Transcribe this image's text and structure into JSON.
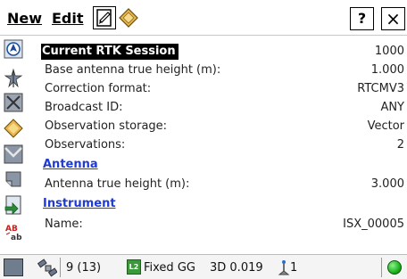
{
  "menu": {
    "new_label": "New",
    "edit_label": "Edit",
    "help_label": "?",
    "close_label": "×"
  },
  "session": {
    "title": "Current RTK Session",
    "title_value": "1000",
    "rows": [
      {
        "label": "Base antenna true height (m):",
        "value": "1.000"
      },
      {
        "label": "Correction format:",
        "value": "RTCMV3"
      },
      {
        "label": "Broadcast ID:",
        "value": "ANY"
      },
      {
        "label": "Observation storage:",
        "value": "Vector"
      },
      {
        "label": "Observations:",
        "value": "2"
      }
    ]
  },
  "antenna": {
    "title": "Antenna",
    "rows": [
      {
        "label": "Antenna true height (m):",
        "value": "3.000"
      }
    ]
  },
  "instrument": {
    "title": "Instrument",
    "rows": [
      {
        "label": "Name:",
        "value": "ISX_00005"
      }
    ]
  },
  "status": {
    "satellites": "9 (13)",
    "fix_icon_label": "L2",
    "solution": "Fixed GG",
    "precision": "3D 0.019",
    "station_count": "1",
    "status_color": "#1db31d"
  },
  "left_toolbar": [
    "navigate-icon",
    "survey-icon",
    "cogo-icon",
    "codes-icon",
    "map-icon",
    "tape-icon",
    "export-icon",
    "calc-icon",
    "menu-icon"
  ]
}
